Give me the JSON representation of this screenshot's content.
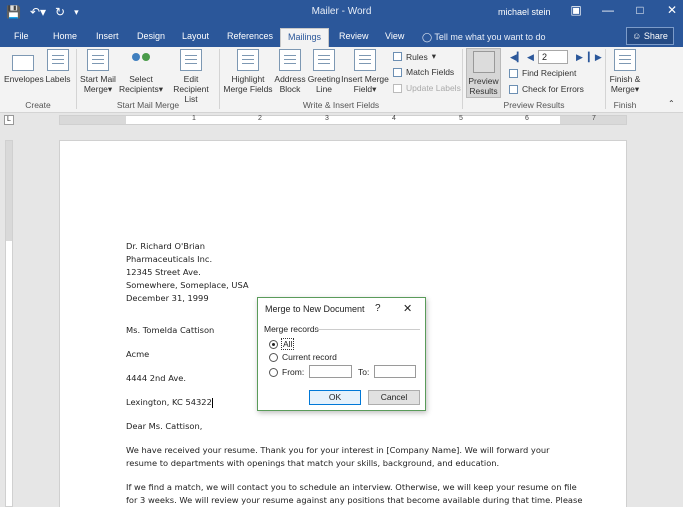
{
  "window": {
    "title": "Mailer - Word",
    "user": "michael stein"
  },
  "quick_access": {
    "save_icon": "save-icon",
    "undo_icon": "undo-icon",
    "redo_icon": "redo-icon",
    "customize_icon": "customize-icon"
  },
  "tabs": [
    "File",
    "Home",
    "Insert",
    "Design",
    "Layout",
    "References",
    "Mailings",
    "Review",
    "View"
  ],
  "active_tab": "Mailings",
  "tell_me": "Tell me what you want to do",
  "share_label": "Share",
  "ribbon": {
    "groups": {
      "create": "Create",
      "start_mail_merge": "Start Mail Merge",
      "write_insert": "Write & Insert Fields",
      "preview": "Preview Results",
      "finish": "Finish"
    },
    "envelopes": "Envelopes",
    "labels": "Labels",
    "start_mail_merge_l1": "Start Mail",
    "start_mail_merge_l2": "Merge",
    "select_recipients_l1": "Select",
    "select_recipients_l2": "Recipients",
    "edit_recipient_l1": "Edit",
    "edit_recipient_l2": "Recipient List",
    "highlight_l1": "Highlight",
    "highlight_l2": "Merge Fields",
    "address_l1": "Address",
    "address_l2": "Block",
    "greeting_l1": "Greeting",
    "greeting_l2": "Line",
    "insert_merge_l1": "Insert Merge",
    "insert_merge_l2": "Field",
    "rules": "Rules",
    "match_fields": "Match Fields",
    "update_labels": "Update Labels",
    "preview_l1": "Preview",
    "preview_l2": "Results",
    "record_number": "2",
    "find_recipient": "Find Recipient",
    "check_errors": "Check for Errors",
    "finish_l1": "Finish &",
    "finish_l2": "Merge"
  },
  "ruler_numbers": [
    "1",
    "2",
    "3",
    "4",
    "5",
    "6",
    "7"
  ],
  "letter": {
    "sender": [
      "Dr. Richard O'Brian",
      "Pharmaceuticals Inc.",
      "12345 Street Ave.",
      "Somewhere, Someplace, USA",
      "December 31, 1999"
    ],
    "recipient_name": "Ms. Tomelda Cattison",
    "company": "Acme",
    "address1": "4444 2nd Ave.",
    "address2": "Lexington, KC 54322",
    "salutation": "Dear Ms. Cattison,",
    "para1_l1": "We have received your resume. Thank you for your interest in [Company Name]. We will forward your",
    "para1_l2": "resume to departments with openings that match your skills, background, and education.",
    "para2_l1": "If we find a match, we will contact you to schedule an interview. Otherwise, we will keep your resume on file",
    "para2_l2": "for 3 weeks. We will review your resume against any positions that become available during that time. Please"
  },
  "dialog": {
    "title": "Merge to New Document",
    "help": "?",
    "close": "✕",
    "group_label": "Merge records",
    "opt_all": "All",
    "opt_current": "Current record",
    "opt_from": "From:",
    "to_label": "To:",
    "from_value": "",
    "to_value": "",
    "ok": "OK",
    "cancel": "Cancel",
    "selected": "All"
  }
}
